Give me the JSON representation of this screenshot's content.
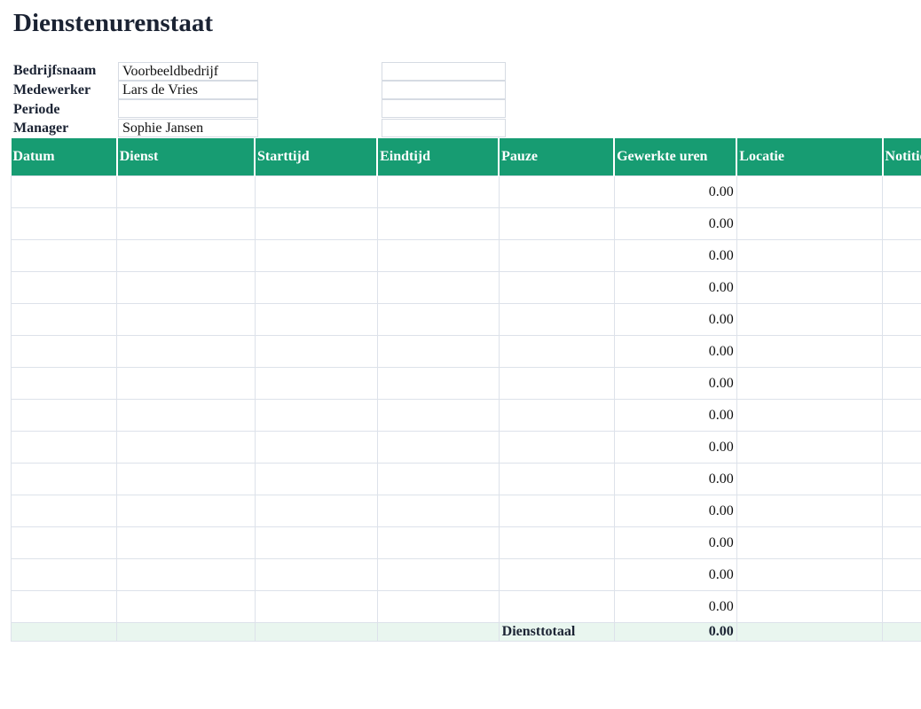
{
  "title": "Dienstenurenstaat",
  "info": {
    "company_label": "Bedrijfsnaam",
    "company_value": "Voorbeeldbedrijf",
    "employee_label": "Medewerker",
    "employee_value": "Lars de Vries",
    "period_label": "Periode",
    "period_value": "",
    "manager_label": "Manager",
    "manager_value": "Sophie Jansen"
  },
  "table": {
    "headers": [
      "Datum",
      "Dienst",
      "Starttijd",
      "Eindtijd",
      "Pauze",
      "Gewerkte uren",
      "Locatie",
      "Notities"
    ],
    "rows_hours": [
      "0.00",
      "0.00",
      "0.00",
      "0.00",
      "0.00",
      "0.00",
      "0.00",
      "0.00",
      "0.00",
      "0.00",
      "0.00",
      "0.00",
      "0.00",
      "0.00"
    ],
    "total_label": "Diensttotaal",
    "total_value": "0.00"
  },
  "colors": {
    "header_bg": "#179c72",
    "total_bg": "#e9f6ef",
    "grid_border": "#dde2ea"
  }
}
